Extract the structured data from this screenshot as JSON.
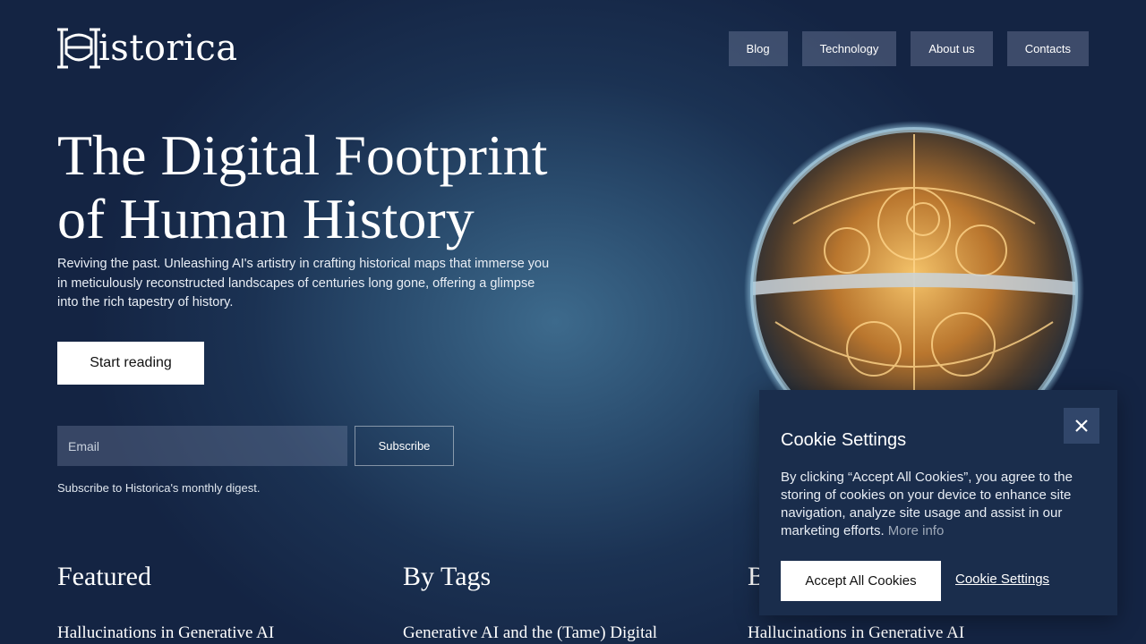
{
  "brand": {
    "name": "istorica"
  },
  "nav": {
    "items": [
      "Blog",
      "Technology",
      "About us",
      "Contacts"
    ]
  },
  "hero": {
    "title_line1": "The Digital Footprint",
    "title_line2": "of Human History",
    "subtitle": "Reviving the past. Unleashing AI's artistry in crafting historical maps that immerse you in meticulously reconstructed landscapes of centuries long gone, offering a glimpse into the rich tapestry of history.",
    "cta_label": "Start reading"
  },
  "subscribe": {
    "email_placeholder": "Email",
    "button_label": "Subscribe",
    "note": "Subscribe to Historica's monthly digest."
  },
  "sections": [
    {
      "title": "Featured",
      "first_item": "Hallucinations in Generative AI"
    },
    {
      "title": "By Tags",
      "first_item": "Generative AI and the (Tame) Digital"
    },
    {
      "title": "B",
      "first_item": "Hallucinations in Generative AI"
    }
  ],
  "cookie": {
    "title": "Cookie Settings",
    "text": "By clicking “Accept All Cookies”, you agree to the storing of cookies on your device to enhance site navigation, analyze site usage and assist in our marketing efforts.",
    "more_info": "More info",
    "accept_label": "Accept All Cookies",
    "settings_label": "Cookie Settings"
  },
  "colors": {
    "background": "#1b3253",
    "accent": "#ffffff",
    "cookie_bg": "#1a2d4c"
  }
}
